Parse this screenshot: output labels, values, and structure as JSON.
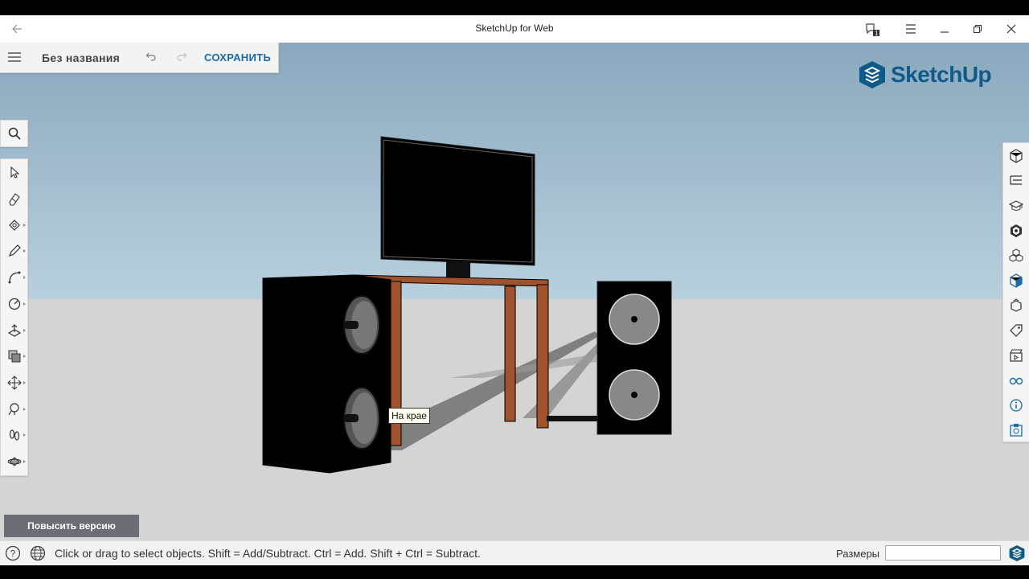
{
  "window": {
    "title": "SketchUp for Web",
    "notification_count": "1"
  },
  "document": {
    "name": "Без названия",
    "save_label": "СОХРАНИТЬ"
  },
  "brand": {
    "logo_text": "SketchUp",
    "color": "#0e5a8a"
  },
  "left_toolbar": {
    "search_icon": "search-icon",
    "tools": [
      "select-icon",
      "eraser-icon",
      "paint-bucket-icon",
      "pencil-icon",
      "arc-icon",
      "tape-measure-icon",
      "push-pull-icon",
      "offset-icon",
      "move-icon",
      "rotate-icon",
      "walk-icon",
      "orbit-icon"
    ]
  },
  "right_panel": {
    "icons": [
      "entity-info-icon",
      "outliner-icon",
      "instructor-icon",
      "materials-icon",
      "components-icon",
      "styles-icon",
      "scenes-icon",
      "tags-icon",
      "animation-icon",
      "display-icon",
      "model-info-icon",
      "solar-icon"
    ]
  },
  "viewport": {
    "tooltip": "На крае"
  },
  "upgrade_label": "Повысить версию",
  "status": {
    "message": "Click or drag to select objects. Shift = Add/Subtract. Ctrl = Add. Shift + Ctrl = Subtract.",
    "dimensions_label": "Размеры",
    "dimensions_value": ""
  },
  "colors": {
    "accent": "#1b6ba8",
    "table_wood": "#a0522d"
  }
}
